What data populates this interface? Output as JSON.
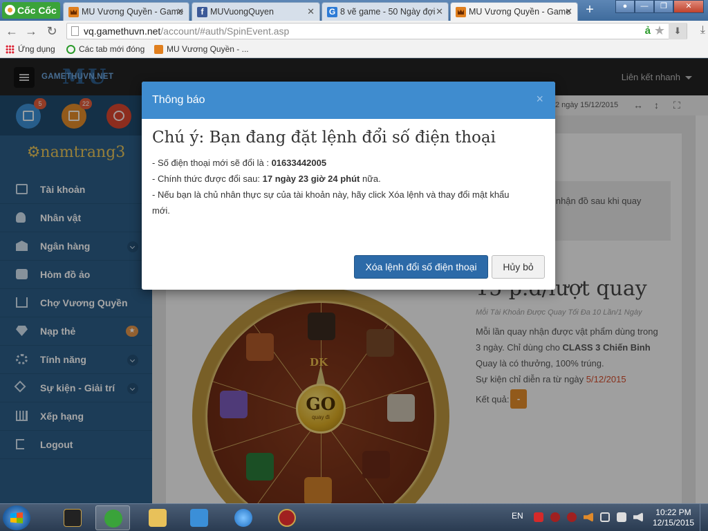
{
  "browser": {
    "logo": "Cốc Cốc",
    "tabs": [
      {
        "title": "MU Vương Quyền - Game",
        "favicon": "mu-icon"
      },
      {
        "title": "MUVuongQuyen",
        "favicon": "facebook-icon"
      },
      {
        "title": "8 vẽ game - 50 Ngày đợi",
        "favicon": "g-icon"
      },
      {
        "title": "MU Vương Quyền - Game",
        "favicon": "mu-icon",
        "active": true
      }
    ],
    "url_host": "vq.gamethuvn.net",
    "url_path": "/account/#auth/SpinEvent.asp",
    "bookmarks": [
      "Ứng dụng",
      "Các tab mới đóng",
      "MU Vương Quyền - ..."
    ]
  },
  "site": {
    "logo_text": "GAMETHUVN.NET",
    "logo_mu": "MU",
    "quick_links": "Liên kết nhanh",
    "shortcuts": [
      {
        "icon": "calendar-icon",
        "badge": "5",
        "color": "#3d8fd4"
      },
      {
        "icon": "list-icon",
        "badge": "22",
        "color": "#e08a2a"
      },
      {
        "icon": "chat-icon",
        "badge": "",
        "color": "#d9452f"
      }
    ],
    "toolbar_date": "2 ngày 15/12/2015",
    "username": "namtrang3",
    "menu": [
      {
        "label": "Tài khoản",
        "icon": "edit-icon",
        "suffix": ""
      },
      {
        "label": "Nhân vật",
        "icon": "user-icon",
        "suffix": ""
      },
      {
        "label": "Ngân hàng",
        "icon": "bank-icon",
        "suffix": "chevron"
      },
      {
        "label": "Hòm đồ ảo",
        "icon": "briefcase-icon",
        "suffix": ""
      },
      {
        "label": "Chợ Vương Quyền",
        "icon": "cart-icon",
        "suffix": ""
      },
      {
        "label": "Nạp thẻ",
        "icon": "diamond-icon",
        "suffix": "star"
      },
      {
        "label": "Tính năng",
        "icon": "cogs-icon",
        "suffix": "chevron"
      },
      {
        "label": "Sự kiện - Giải trí",
        "icon": "event-icon",
        "suffix": "chevron"
      },
      {
        "label": "Xếp hạng",
        "icon": "chart-icon",
        "suffix": ""
      },
      {
        "label": "Logout",
        "icon": "logout-icon",
        "suffix": ""
      }
    ],
    "notice_partial": "ể nhận đồ sau khi quay",
    "spin": {
      "price": "15 p.đ/lượt quay",
      "limit": "Mỗi Tài Khoản Được Quay Tối Đa 10 Lần/1 Ngày",
      "desc_prefix": "Mỗi lần quay nhận được vật phẩm dùng trong 3 ngày. Chỉ dùng cho ",
      "desc_bold": "CLASS 3 Chiến Binh",
      "desc2": "Quay là có thưởng, 100% trúng.",
      "event_label": "Sự kiện chỉ diễn ra từ ngày ",
      "event_date": "5/12/2015",
      "result_label": "Kết quả:",
      "result_value": "-",
      "go_label": "GO",
      "go_sub": "quay đi",
      "dk_label": "DK"
    }
  },
  "modal": {
    "title": "Thông báo",
    "close": "×",
    "heading": "Chú ý: Bạn đang đặt lệnh đổi số điện thoại",
    "line1_prefix": "- Số điện thoại mới sẽ đổi là : ",
    "phone": "01633442005",
    "line2_prefix": "- Chính thức được đổi sau: ",
    "countdown": "17 ngày 23 giờ 24 phút",
    "line2_suffix": " nữa.",
    "line3a": "- Nếu bạn là chủ nhân thực sự của tài khoản này, hãy click Xóa lệnh và thay đổi mật khẩu",
    "line3b": "mới.",
    "confirm_button": "Xóa lệnh đổi số điện thoại",
    "cancel_button": "Hủy bỏ"
  },
  "taskbar": {
    "language": "EN",
    "time": "10:22 PM",
    "date": "12/15/2015"
  }
}
